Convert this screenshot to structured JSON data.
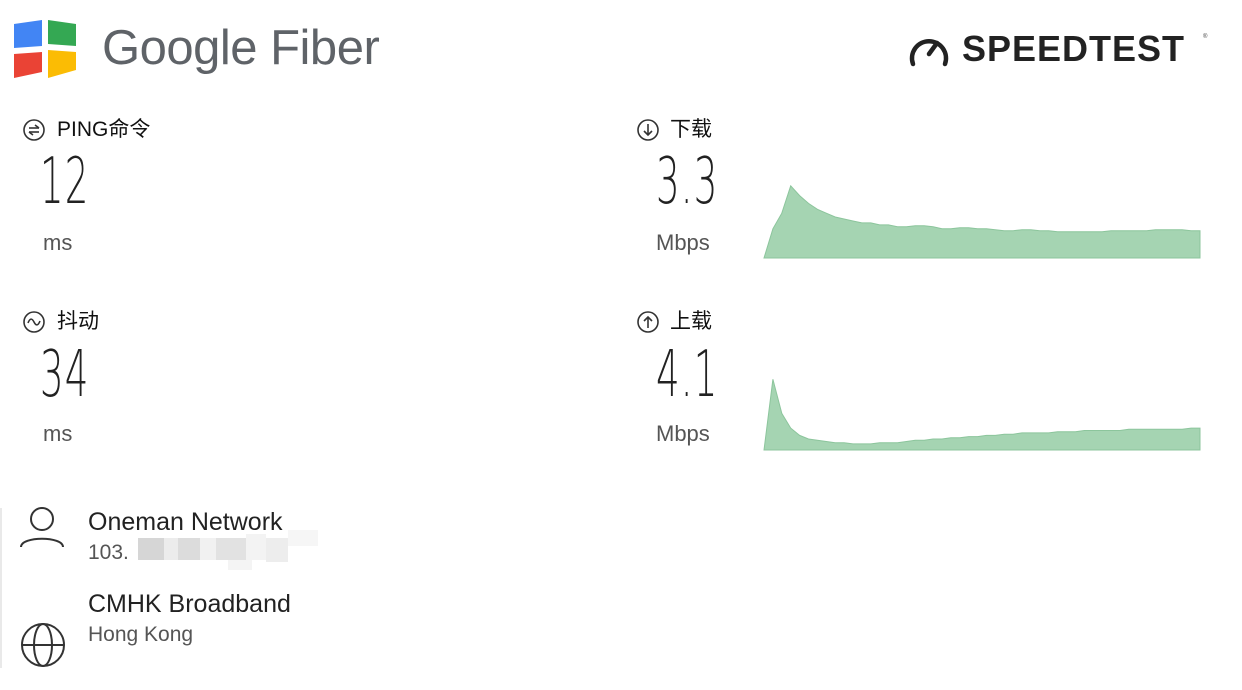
{
  "header": {
    "brand_name": "Google Fiber",
    "speedtest_label": "SPEEDTEST",
    "speedtest_reg": "®",
    "logo_colors": {
      "blue": "#4285F4",
      "green": "#34A853",
      "red": "#EA4335",
      "yellow": "#FBBC04"
    }
  },
  "metrics": {
    "ping": {
      "label": "PING命令",
      "value": "12",
      "unit": "ms",
      "icon": "ping-icon"
    },
    "jitter": {
      "label": "抖动",
      "value": "34",
      "unit": "ms",
      "icon": "jitter-icon"
    },
    "download": {
      "label": "下载",
      "value": "3.3",
      "unit": "Mbps",
      "icon": "download-arrow-icon"
    },
    "upload": {
      "label": "上载",
      "value": "4.1",
      "unit": "Mbps",
      "icon": "upload-arrow-icon"
    }
  },
  "chart_data": [
    {
      "type": "area",
      "series": [
        {
          "values": [
            0,
            30,
            46,
            74,
            64,
            56,
            50,
            46,
            42,
            40,
            38,
            36,
            36,
            34,
            34,
            32,
            32,
            33,
            33,
            32,
            30,
            30,
            31,
            31,
            30,
            30,
            29,
            28,
            28,
            29,
            29,
            28,
            28,
            27,
            27,
            27,
            27,
            27,
            27,
            28,
            28,
            28,
            28,
            28,
            29,
            29,
            29,
            29,
            28,
            28
          ]
        }
      ],
      "color": "#a5d4b2"
    },
    {
      "type": "area",
      "series": [
        {
          "values": [
            0,
            58,
            30,
            18,
            12,
            9,
            8,
            7,
            6,
            6,
            5,
            5,
            5,
            6,
            6,
            6,
            7,
            8,
            8,
            9,
            9,
            10,
            10,
            11,
            11,
            12,
            12,
            13,
            13,
            14,
            14,
            14,
            14,
            15,
            15,
            15,
            16,
            16,
            16,
            16,
            16,
            17,
            17,
            17,
            17,
            17,
            17,
            17,
            18,
            18
          ]
        }
      ],
      "color": "#a5d4b2"
    }
  ],
  "client": {
    "isp_name": "Oneman Network",
    "ip_prefix": "103."
  },
  "server": {
    "name": "CMHK Broadband",
    "location": "Hong Kong"
  }
}
